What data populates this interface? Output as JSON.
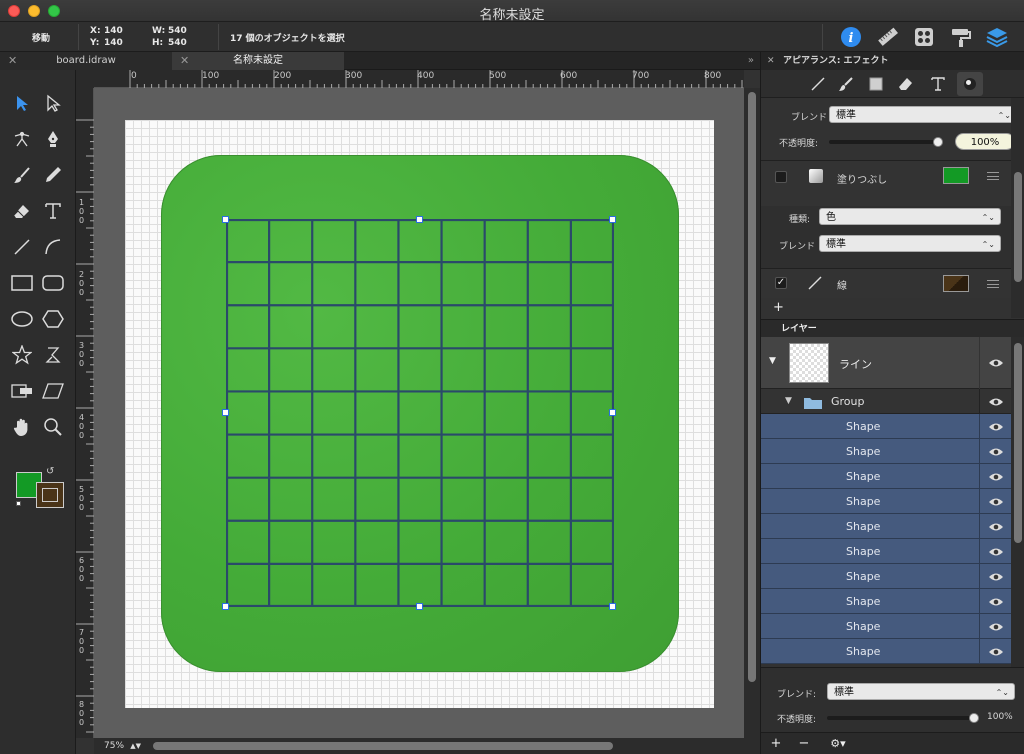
{
  "window": {
    "title": "名称未設定"
  },
  "toolbar": {
    "mode": "移動",
    "x_label": "X:",
    "x_value": "140",
    "y_label": "Y:",
    "y_value": "140",
    "w_label": "W:",
    "w_value": "540",
    "h_label": "H:",
    "h_value": "540",
    "selection": "17 個のオブジェクトを選択"
  },
  "tabs": [
    {
      "label": "board.idraw",
      "active": false
    },
    {
      "label": "名称未設定",
      "active": true
    }
  ],
  "tabs_more": "»",
  "ruler": {
    "h_labels": [
      "0",
      "100",
      "200",
      "300",
      "400",
      "500",
      "600",
      "700",
      "800"
    ],
    "v_labels": [
      "1\n0\n0",
      "2\n0\n0",
      "3\n0\n0",
      "4\n0\n0",
      "5\n0\n0",
      "6\n0\n0",
      "7\n0\n0",
      "8\n0\n0"
    ]
  },
  "zoom": {
    "value": "75%"
  },
  "canvas": {
    "board_color": "#44ab38",
    "grid_line_color": "#2a4a6a",
    "grid_cells": 9
  },
  "appearance": {
    "header": "アピアランス: エフェクト",
    "blend_label": "ブレンド",
    "blend_value": "標準",
    "opacity_label": "不透明度:",
    "opacity_value": "100%",
    "fill_label": "塗りつぶし",
    "fill_color": "#139a25",
    "kind_label": "種類:",
    "kind_value": "色",
    "blend2_label": "ブレンド",
    "blend2_value": "標準",
    "stroke_label": "線",
    "stroke_color": "#4a3418",
    "add": "+"
  },
  "layers": {
    "header": "レイヤー",
    "top_layer": "ライン",
    "group": "Group",
    "shapes": [
      "Shape",
      "Shape",
      "Shape",
      "Shape",
      "Shape",
      "Shape",
      "Shape",
      "Shape",
      "Shape",
      "Shape"
    ]
  },
  "bottom": {
    "blend_label": "ブレンド:",
    "blend_value": "標準",
    "opacity_label": "不透明度:",
    "opacity_value": "100%",
    "add": "+",
    "remove": "−",
    "gear": "⚙▾"
  }
}
